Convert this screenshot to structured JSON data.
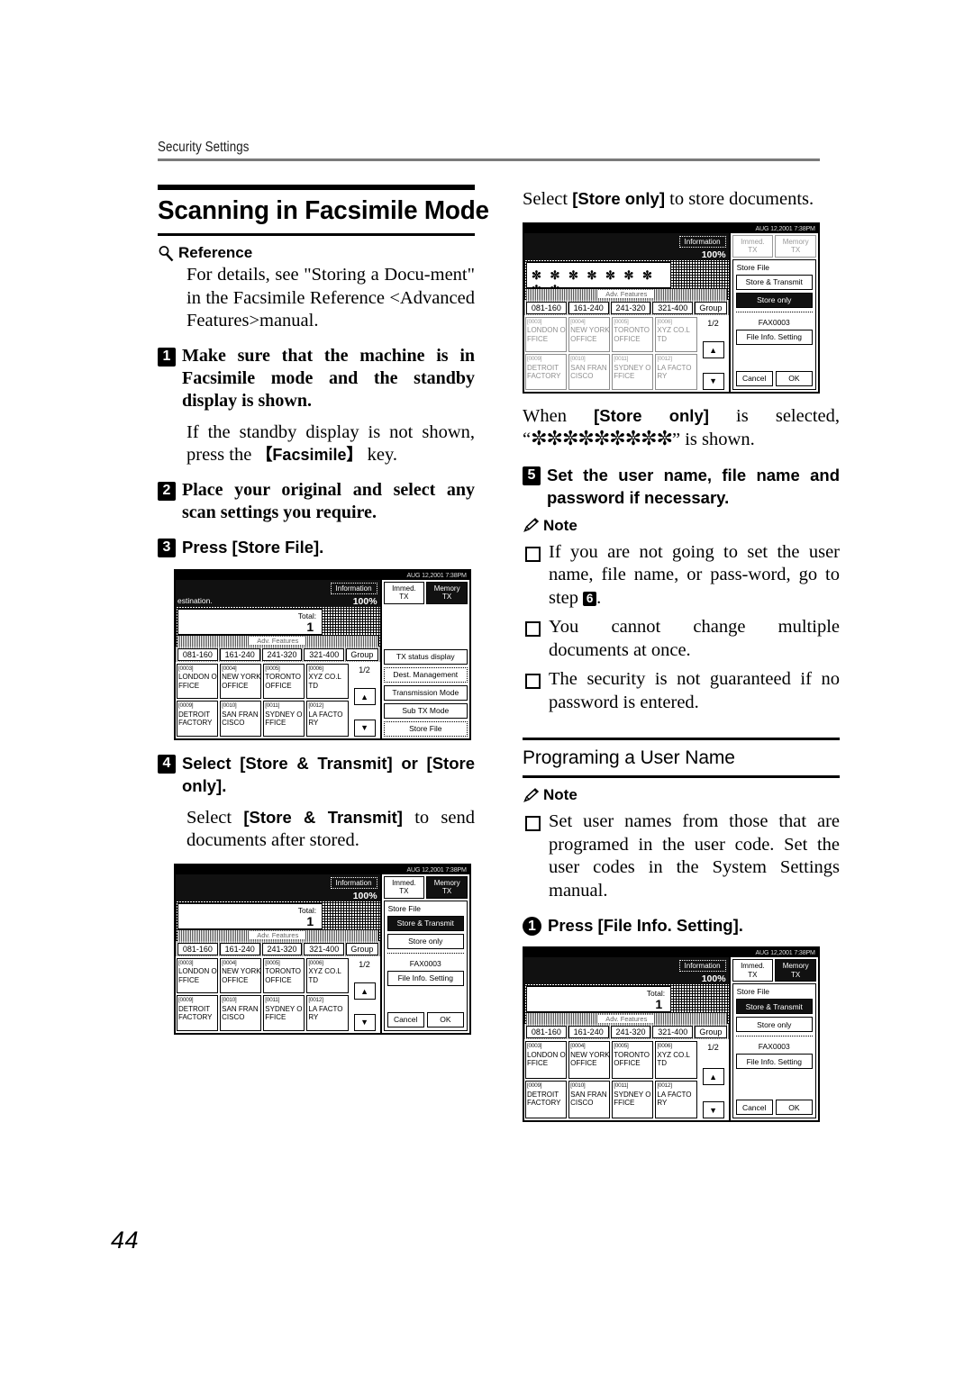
{
  "header": {
    "running_head": "Security Settings"
  },
  "page_number": "44",
  "left_column": {
    "title": "Scanning in Facsimile Mode",
    "reference": {
      "icon": "magnifier-icon",
      "label": "Reference",
      "text": "For details, see \"Storing a Docu-ment\" in the Facsimile Reference <Advanced Features>manual."
    },
    "step1": {
      "number": "1",
      "bold_text": "Make sure that the machine is in Facsimile mode and the standby display is shown.",
      "body_pre": "If the standby display is not shown, press the ",
      "keycap": "【Facsimile】",
      "body_post": " key."
    },
    "step2": {
      "number": "2",
      "bold_text": "Place your original and select any scan settings you require."
    },
    "step3": {
      "number": "3",
      "bold_text": "Press [Store File]."
    },
    "step4": {
      "number": "4",
      "bold_text": "Select [Store & Transmit] or [Store only].",
      "body_pre": "Select ",
      "body_bold": "[Store & Transmit]",
      "body_post": " to send documents after stored."
    }
  },
  "right_column": {
    "intro": {
      "pre": "Select ",
      "bold": "[Store only]",
      "post": " to store documents."
    },
    "after_panel": {
      "pre": "When ",
      "bold": "[Store only]",
      "mid": " is selected, “",
      "stars": "✼✼✼✼✼✼✼✼✼",
      "post": "” is shown."
    },
    "step5": {
      "number": "5",
      "bold_text": "Set the user name, file name and password if necessary."
    },
    "note1": {
      "icon": "pencil-icon",
      "label": "Note",
      "bullets": [
        {
          "pre": "If you are not going to set the user name, file name, or pass-word, go to step ",
          "step_ref": "6",
          "post": "."
        },
        {
          "pre": "You cannot change multiple documents at once.",
          "step_ref": "",
          "post": ""
        },
        {
          "pre": "The security is not guaranteed if no password is entered.",
          "step_ref": "",
          "post": ""
        }
      ]
    },
    "section2": {
      "title": "Programing a User Name",
      "note": {
        "icon": "pencil-icon",
        "label": "Note",
        "bullets": [
          {
            "pre": "Set user names from those that are programed in the user code. Set the user codes in the System Settings manual.",
            "step_ref": "",
            "post": ""
          }
        ]
      },
      "step_a": {
        "number": "1",
        "bold_text": "Press [File Info. Setting]."
      }
    }
  },
  "fax_panel_common": {
    "timestamp": "AUG  12,2001  7:38PM",
    "information_button": "Information",
    "zoom_percent": "100%",
    "total_label": "Total:",
    "total_value": "1",
    "adv_features": "Adv. Features",
    "range_tabs": [
      "081-160",
      "161-240",
      "241-320",
      "321-400"
    ],
    "group_tab": "Group",
    "page_fraction": "1/2",
    "up_arrow": "▲",
    "down_arrow": "▼",
    "immed_tx": "Immed.\nTX",
    "memory_tx": "Memory\nTX",
    "destinations": [
      {
        "code": "[0003]",
        "line1": "LONDON O",
        "line2": "FFICE"
      },
      {
        "code": "[0004]",
        "line1": "NEW YORK",
        "line2": " OFFICE"
      },
      {
        "code": "[0005]",
        "line1": "TORONTO",
        "line2": "OFFICE"
      },
      {
        "code": "[0006]",
        "line1": "XYZ CO.L",
        "line2": "TD"
      },
      {
        "code": "[0009]",
        "line1": "DETROIT",
        "line2": "FACTORY"
      },
      {
        "code": "[0010]",
        "line1": "SAN FRAN",
        "line2": "CISCO"
      },
      {
        "code": "[0011]",
        "line1": "SYDNEY O",
        "line2": "FFICE"
      },
      {
        "code": "[0012]",
        "line1": "LA FACTO",
        "line2": "RY"
      }
    ]
  },
  "fax_panel_1": {
    "status_text": "estination.",
    "right_buttons": [
      "TX status display",
      "Dest. Management",
      "Transmission Mode",
      "Sub TX Mode",
      "Store File"
    ],
    "immed_on": false,
    "memory_on": true
  },
  "fax_panel_2": {
    "store_file_label": "Store File",
    "store_transmit": "Store & Transmit",
    "store_only": "Store only",
    "fax_id": "FAX0003",
    "file_info_setting": "File Info. Setting",
    "cancel": "Cancel",
    "ok": "OK",
    "selected": "Store & Transmit"
  },
  "fax_panel_3": {
    "stars": "✼ ✼ ✼ ✼ ✼ ✼ ✼ ✼ ✼",
    "store_file_label": "Store File",
    "store_transmit": "Store & Transmit",
    "store_only": "Store only",
    "fax_id": "FAX0003",
    "file_info_setting": "File Info. Setting",
    "cancel": "Cancel",
    "ok": "OK",
    "selected": "Store only"
  },
  "fax_panel_4": {
    "store_file_label": "Store File",
    "store_transmit": "Store & Transmit",
    "store_only": "Store only",
    "fax_id": "FAX0003",
    "file_info_setting": "File Info. Setting",
    "cancel": "Cancel",
    "ok": "OK",
    "selected": "Store & Transmit"
  }
}
